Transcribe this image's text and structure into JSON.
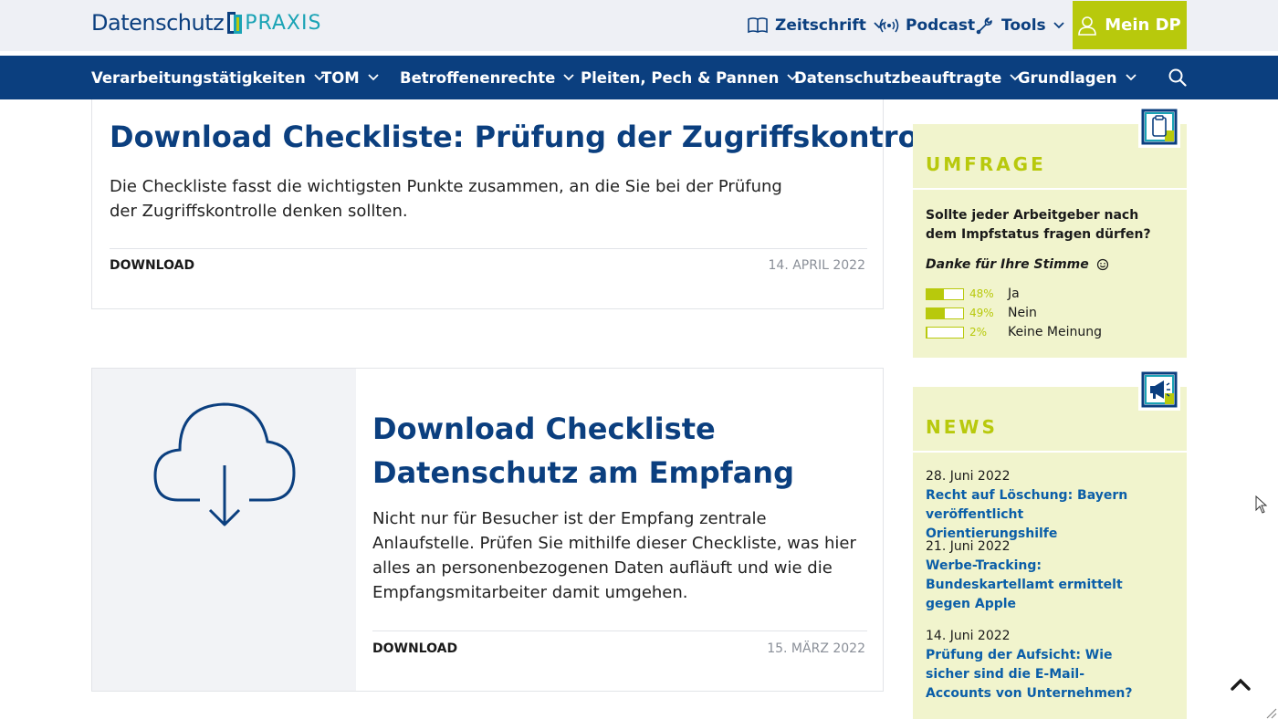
{
  "header": {
    "logo": {
      "word1": "Datenschutz",
      "word2": "PRAXIS"
    },
    "nav": [
      {
        "label": "Zeitschrift",
        "icon": "book-icon",
        "has_dropdown": true
      },
      {
        "label": "Podcast",
        "icon": "broadcast-icon",
        "has_dropdown": false
      },
      {
        "label": "Tools",
        "icon": "wrench-icon",
        "has_dropdown": true
      }
    ],
    "account_button": {
      "label": "Mein DP",
      "icon": "user-icon"
    }
  },
  "main_nav": {
    "items": [
      {
        "label": "Verarbeitungstätigkeiten"
      },
      {
        "label": "TOM"
      },
      {
        "label": "Betroffenenrechte"
      },
      {
        "label": "Pleiten, Pech & Pannen"
      },
      {
        "label": "Datenschutzbeauftragte"
      },
      {
        "label": "Grundlagen"
      }
    ],
    "search_icon": "search-icon"
  },
  "articles": [
    {
      "title": "Download Checkliste: Prüfung der Zugriffskontrolle",
      "excerpt": "Die Checkliste fasst die wichtigsten Punkte zusammen, an die Sie bei der Prüfung der Zugriffskontrolle denken sollten.",
      "category": "DOWNLOAD",
      "date": "14. APRIL 2022"
    },
    {
      "title": "Download Checkliste Datenschutz am Empfang",
      "excerpt": "Nicht nur für Besucher ist der Empfang zentrale Anlaufstelle. Prüfen Sie mithilfe dieser Checkliste, was hier alles an personenbezogenen Daten aufläuft und wie die Empfangsmitarbeiter damit umgehen.",
      "category": "DOWNLOAD",
      "date": "15. MÄRZ 2022",
      "thumbnail_icon": "cloud-download-icon"
    }
  ],
  "poll": {
    "title": "UMFRAGE",
    "question": "Sollte jeder Arbeitgeber nach dem Impfstatus fragen dürfen?",
    "thanks": "Danke für Ihre Stimme",
    "options": [
      {
        "pct": "48%",
        "label": "Ja",
        "fraction": 0.48
      },
      {
        "pct": "49%",
        "label": "Nein",
        "fraction": 0.49
      },
      {
        "pct": "2%",
        "label": "Keine Meinung",
        "fraction": 0.02
      }
    ],
    "colors": {
      "accent": "#b8c90c",
      "background": "#f1f4cd"
    }
  },
  "news": {
    "title": "NEWS",
    "items": [
      {
        "date": "28. Juni 2022",
        "title": "Recht auf Löschung: Bayern veröffentlicht Orientierungshilfe"
      },
      {
        "date": "21. Juni 2022",
        "title": "Werbe-Tracking: Bundeskartellamt ermittelt gegen Apple"
      },
      {
        "date": "14. Juni 2022",
        "title": "Prüfung der Aufsicht: Wie sicher sind die E-Mail-Accounts von Unternehmen?"
      }
    ]
  },
  "colors": {
    "brand_blue": "#0b3f7f",
    "accent_green": "#b8c90c",
    "teal": "#1aa3b5",
    "link_blue": "#0b5ea8"
  }
}
